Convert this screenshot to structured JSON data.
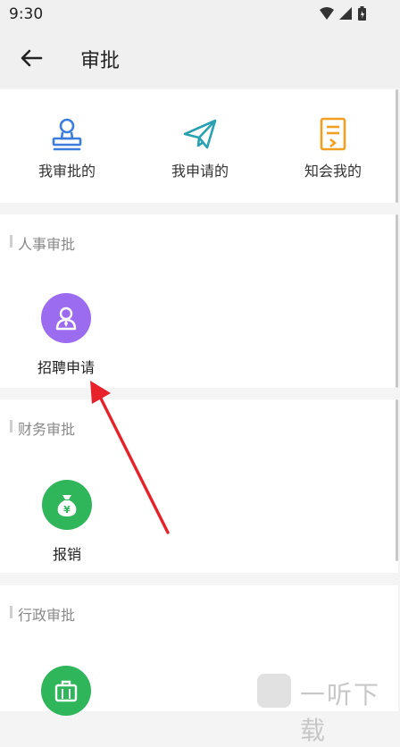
{
  "status_bar": {
    "time": "9:30"
  },
  "header": {
    "title": "审批"
  },
  "quick_actions": [
    {
      "label": "我审批的",
      "icon": "stamp-icon",
      "color": "#3b7ddd"
    },
    {
      "label": "我申请的",
      "icon": "paper-plane-icon",
      "color": "#2aa1b0"
    },
    {
      "label": "知会我的",
      "icon": "document-icon",
      "color": "#f0a020"
    }
  ],
  "sections": [
    {
      "title": "人事审批",
      "items": [
        {
          "label": "招聘申请",
          "icon": "recruit-person-icon",
          "color": "#9b6bf0"
        }
      ]
    },
    {
      "title": "财务审批",
      "items": [
        {
          "label": "报销",
          "icon": "money-bag-icon",
          "color": "#2fb55a"
        }
      ]
    },
    {
      "title": "行政审批",
      "items": [
        {
          "label": "",
          "icon": "briefcase-icon",
          "color": "#2fb55a"
        }
      ]
    }
  ],
  "annotation": {
    "arrow_color": "#e8222b"
  },
  "watermark": {
    "text": "一听下载"
  }
}
